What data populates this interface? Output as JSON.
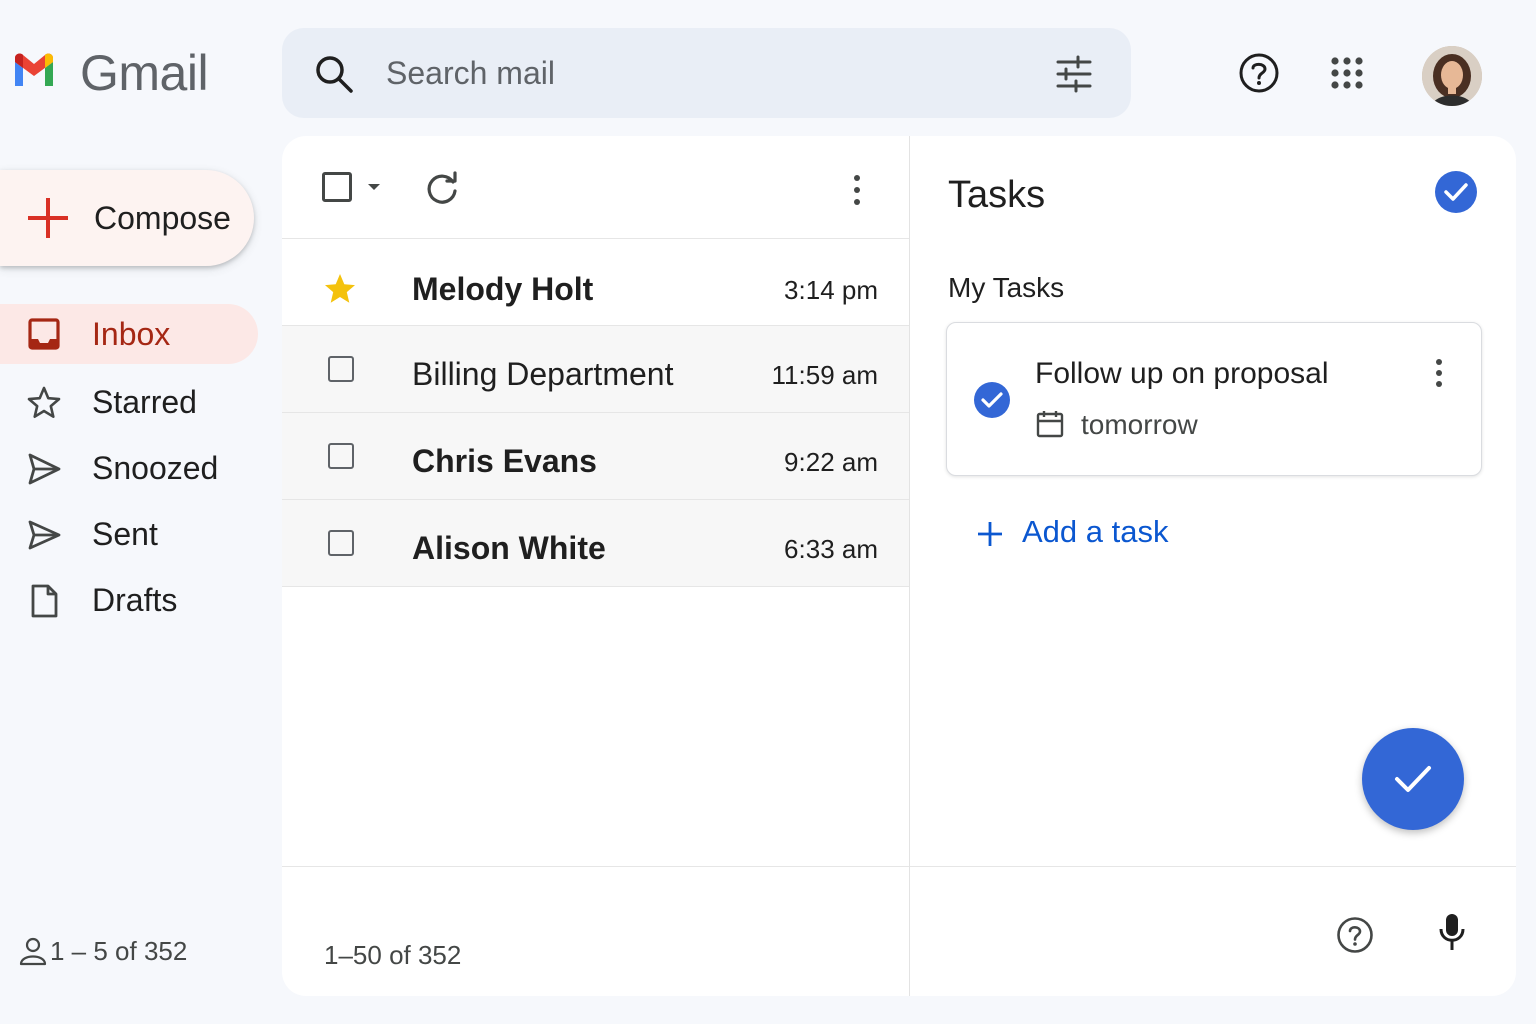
{
  "header": {
    "brand": "Gmail",
    "search_placeholder": "Search mail",
    "icons": [
      "gmail-logo",
      "search-icon",
      "tune-icon",
      "help-icon",
      "apps-icon",
      "avatar"
    ]
  },
  "sidebar": {
    "compose_label": "Compose",
    "items": [
      {
        "label": "Inbox",
        "icon": "inbox-icon",
        "active": true
      },
      {
        "label": "Starred",
        "icon": "star-icon"
      },
      {
        "label": "Snoozed",
        "icon": "snooze-icon"
      },
      {
        "label": "Sent",
        "icon": "send-icon"
      },
      {
        "label": "Drafts",
        "icon": "draft-icon"
      }
    ],
    "footer": "1 – 5 of 352"
  },
  "mail_list": {
    "rows": [
      {
        "sender": "Melody Holt",
        "time": "3:14 pm",
        "starred": true,
        "unread": true
      },
      {
        "sender": "Billing Department",
        "time": "11:59 am",
        "starred": false,
        "unread": false
      },
      {
        "sender": "Chris Evans",
        "time": "9:22 am",
        "starred": false,
        "unread": true
      },
      {
        "sender": "Alison White",
        "time": "6:33 am",
        "starred": false,
        "unread": true
      }
    ],
    "footer": "1–50 of 352"
  },
  "tasks": {
    "title": "Tasks",
    "list_name": "My Tasks",
    "items": [
      {
        "title": "Follow up on proposal",
        "due": "tomorrow",
        "completed": true
      }
    ],
    "add_label": "Add a task"
  },
  "colors": {
    "accent_blue": "#3367d6",
    "link_blue": "#0b57d0",
    "inbox_active_bg": "#fce8e6",
    "inbox_active_text": "#a52714",
    "star_yellow": "#f4c20d",
    "compose_plus": "#d93025"
  }
}
